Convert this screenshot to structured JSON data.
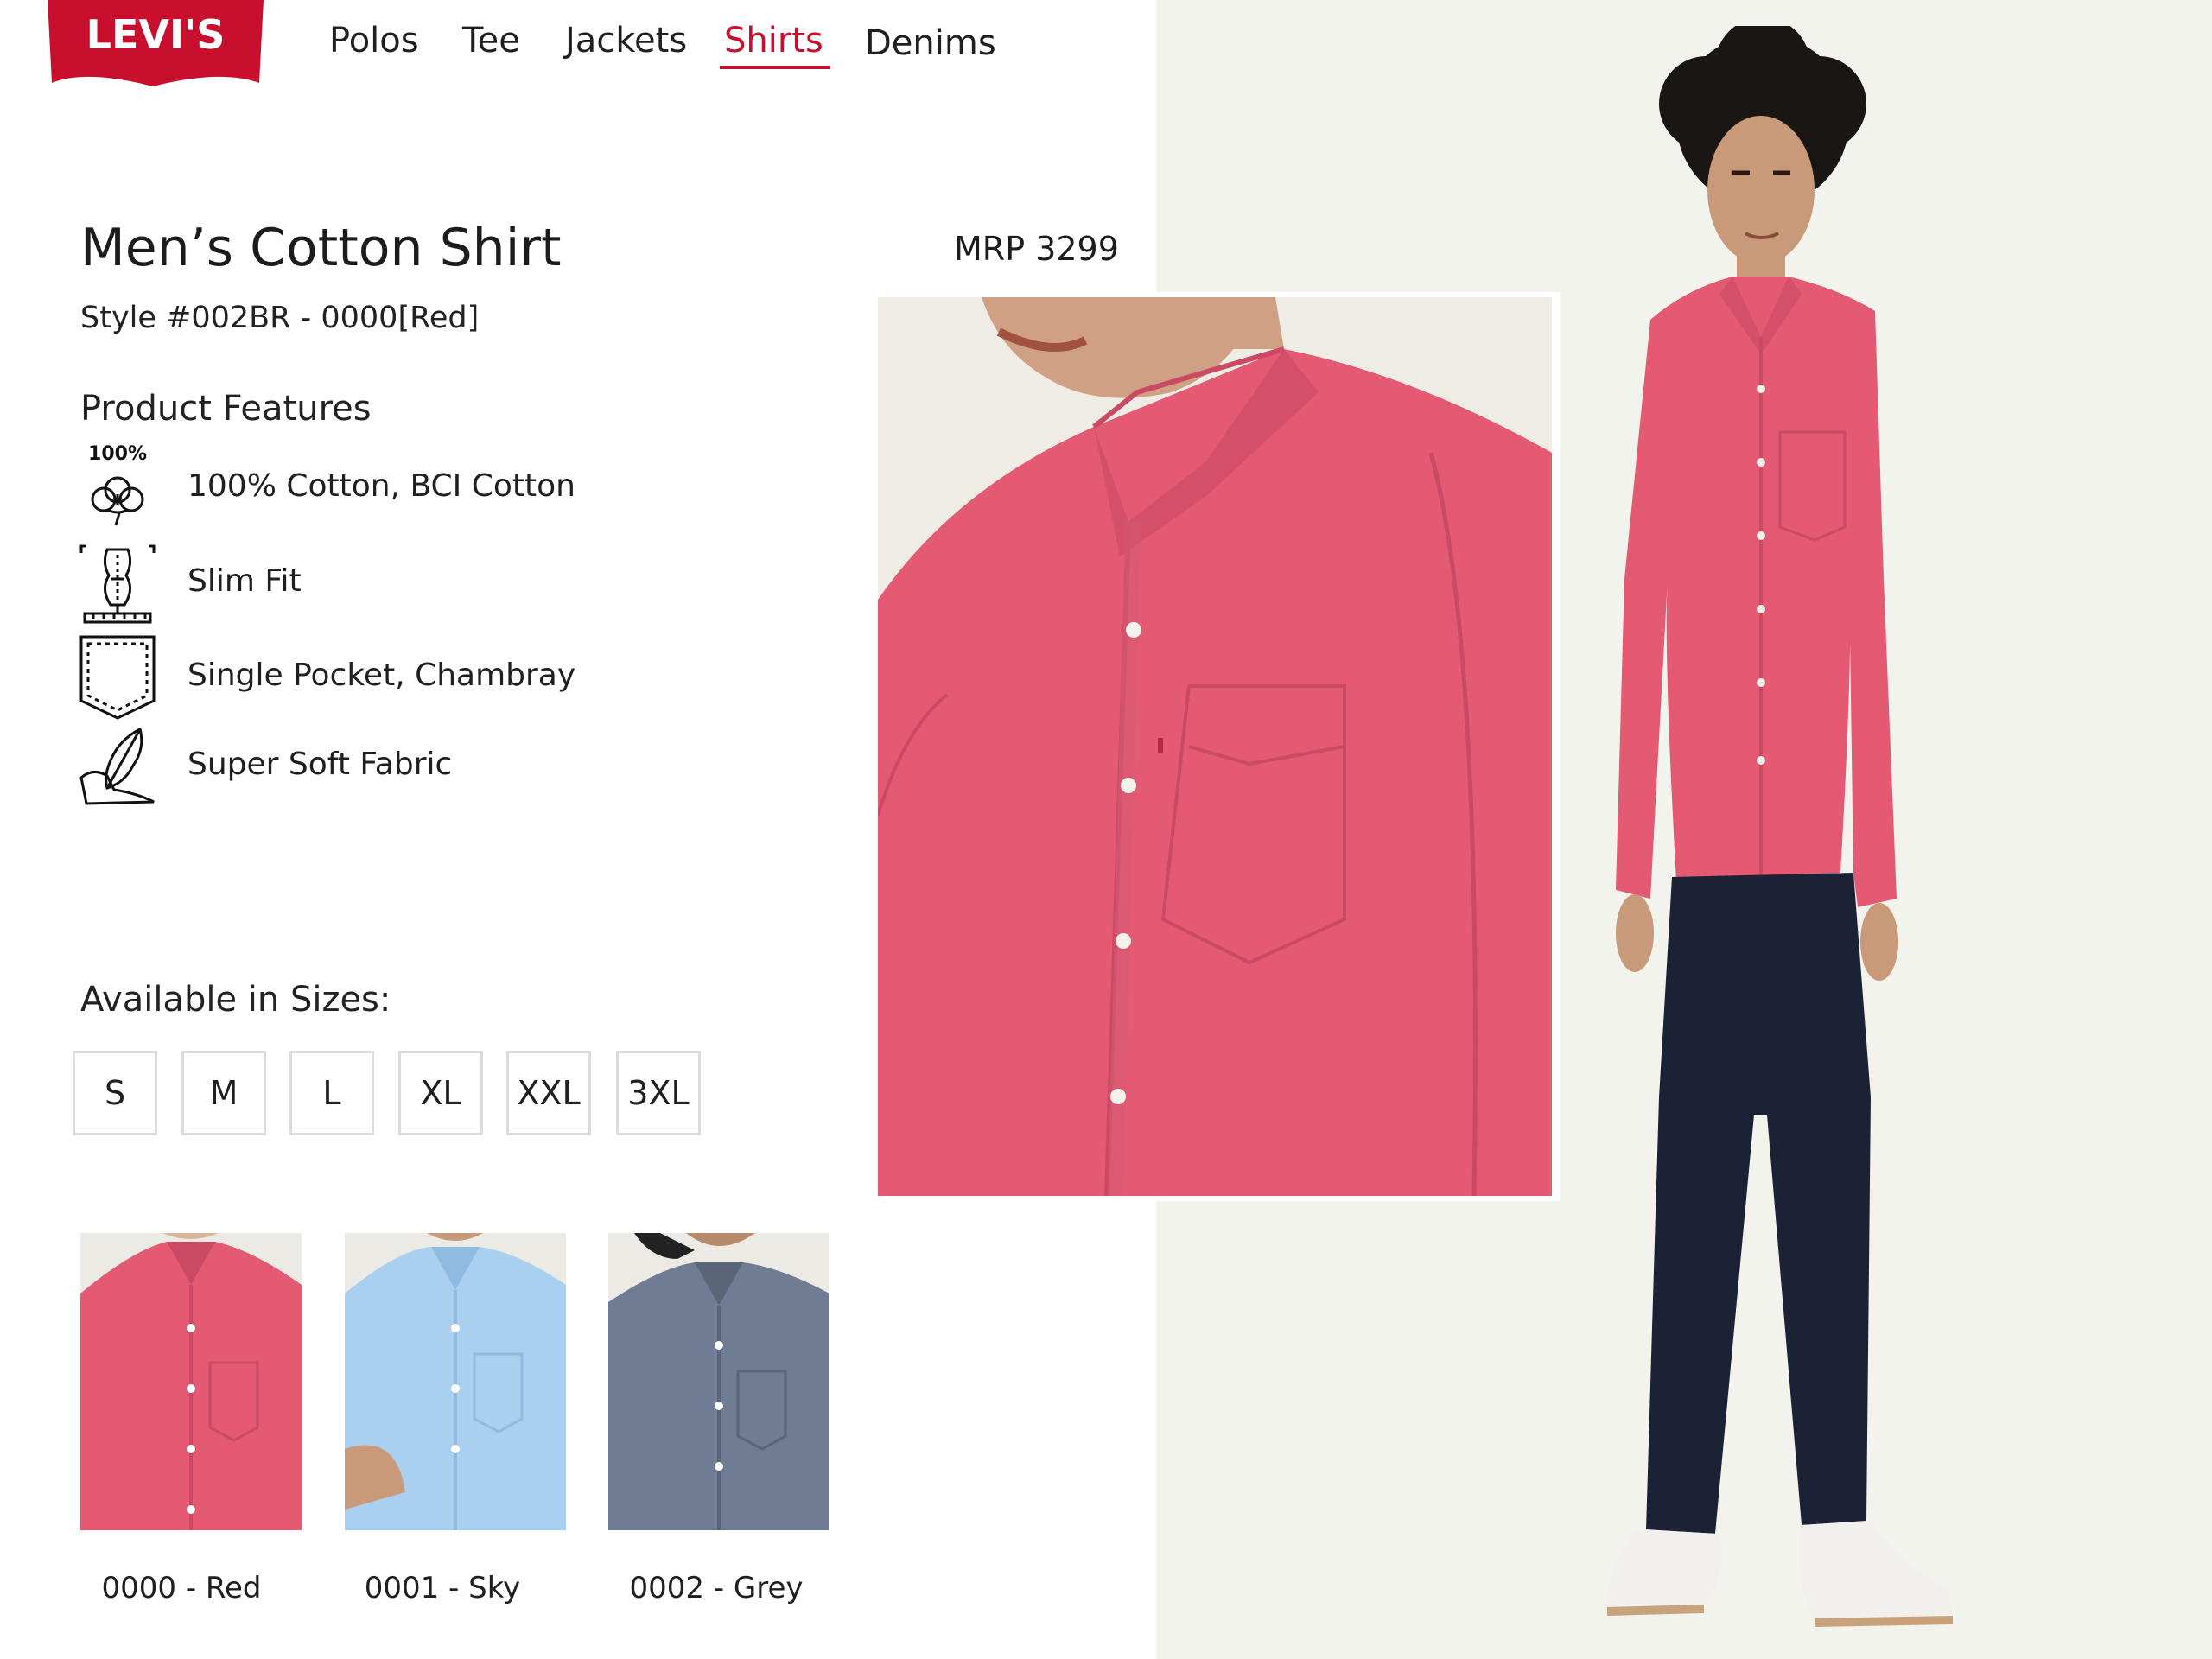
{
  "brand": {
    "logo_text": "LEVI'S",
    "trademark": "®",
    "color": "#c8102e"
  },
  "nav": {
    "items": [
      {
        "label": "Polos",
        "active": false
      },
      {
        "label": "Tee",
        "active": false
      },
      {
        "label": "Jackets",
        "active": false
      },
      {
        "label": "Shirts",
        "active": true
      },
      {
        "label": "Denims",
        "active": false
      }
    ]
  },
  "product": {
    "title": "Men’s Cotton Shirt",
    "style": "Style #002BR - 0000[Red]",
    "price": "MRP 3299"
  },
  "features": {
    "title": "Product Features",
    "items": [
      {
        "icon": "cotton-icon",
        "icon_text": "100%",
        "label": "100% Cotton, BCI Cotton"
      },
      {
        "icon": "slim-fit-icon",
        "label": "Slim Fit"
      },
      {
        "icon": "pocket-icon",
        "label": "Single Pocket, Chambray"
      },
      {
        "icon": "feather-icon",
        "label": "Super Soft Fabric"
      }
    ]
  },
  "sizes": {
    "title": "Available in Sizes:",
    "options": [
      "S",
      "M",
      "L",
      "XL",
      "XXL",
      "3XL"
    ]
  },
  "variants": [
    {
      "label": "0000 - Red",
      "color": "#e35a72"
    },
    {
      "label": "0001 - Sky",
      "color": "#aad0ef"
    },
    {
      "label": "0002 - Grey",
      "color": "#6f7c93"
    }
  ],
  "colors": {
    "accent": "#c8102e",
    "shirt": "#e35a72",
    "jeans": "#1c2236",
    "backdrop": "#f3f3ee"
  }
}
